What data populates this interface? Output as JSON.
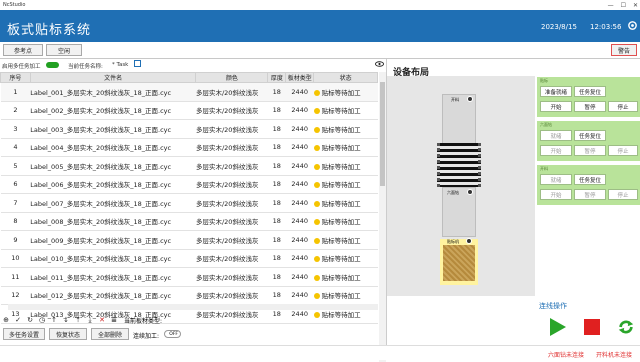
{
  "window": {
    "title": "NcStudio"
  },
  "header": {
    "app_title": "板式贴标系统",
    "date": "2023/8/15",
    "time": "12:03:56"
  },
  "toolbar": {
    "ref_point": "参考点",
    "idle": "空闲",
    "alarm": "警告"
  },
  "options": {
    "multi_task": "启用多任务加工",
    "current_task_label": "当前任务名称:",
    "current_task": "* Task"
  },
  "table": {
    "headers": [
      "序号",
      "文件名",
      "颜色",
      "厚度",
      "板材类型",
      "状态"
    ],
    "rows": [
      [
        "1",
        "Label_001_多层实木_20斜纹浅灰_18_正面.cyc",
        "多层实木/20斜纹浅灰",
        "18",
        "2440",
        "贴标等待加工"
      ],
      [
        "2",
        "Label_002_多层实木_20斜纹浅灰_18_正面.cyc",
        "多层实木/20斜纹浅灰",
        "18",
        "2440",
        "贴标等待加工"
      ],
      [
        "3",
        "Label_003_多层实木_20斜纹浅灰_18_正面.cyc",
        "多层实木/20斜纹浅灰",
        "18",
        "2440",
        "贴标等待加工"
      ],
      [
        "4",
        "Label_004_多层实木_20斜纹浅灰_18_正面.cyc",
        "多层实木/20斜纹浅灰",
        "18",
        "2440",
        "贴标等待加工"
      ],
      [
        "5",
        "Label_005_多层实木_20斜纹浅灰_18_正面.cyc",
        "多层实木/20斜纹浅灰",
        "18",
        "2440",
        "贴标等待加工"
      ],
      [
        "6",
        "Label_006_多层实木_20斜纹浅灰_18_正面.cyc",
        "多层实木/20斜纹浅灰",
        "18",
        "2440",
        "贴标等待加工"
      ],
      [
        "7",
        "Label_007_多层实木_20斜纹浅灰_18_正面.cyc",
        "多层实木/20斜纹浅灰",
        "18",
        "2440",
        "贴标等待加工"
      ],
      [
        "8",
        "Label_008_多层实木_20斜纹浅灰_18_正面.cyc",
        "多层实木/20斜纹浅灰",
        "18",
        "2440",
        "贴标等待加工"
      ],
      [
        "9",
        "Label_009_多层实木_20斜纹浅灰_18_正面.cyc",
        "多层实木/20斜纹浅灰",
        "18",
        "2440",
        "贴标等待加工"
      ],
      [
        "10",
        "Label_010_多层实木_20斜纹浅灰_18_正面.cyc",
        "多层实木/20斜纹浅灰",
        "18",
        "2440",
        "贴标等待加工"
      ],
      [
        "11",
        "Label_011_多层实木_20斜纹浅灰_18_正面.cyc",
        "多层实木/20斜纹浅灰",
        "18",
        "2440",
        "贴标等待加工"
      ],
      [
        "12",
        "Label_012_多层实木_20斜纹浅灰_18_正面.cyc",
        "多层实木/20斜纹浅灰",
        "18",
        "2440",
        "贴标等待加工"
      ],
      [
        "13",
        "Label_013_多层实木_20斜纹浅灰_18_正面.cyc",
        "多层实木/20斜纹浅灰",
        "18",
        "2440",
        "贴标等待加工"
      ]
    ]
  },
  "iconbar": {
    "current_type_label": "当前板材类型:"
  },
  "bottom": {
    "multi_task_settings": "多任务设置",
    "restore_state": "恢复状态",
    "delete_all": "全部删除",
    "continuous": "连续加工:",
    "toggle_state": "OFF"
  },
  "layout": {
    "title": "设备布局",
    "station_feed": "开料",
    "station_unload": "六面钻",
    "station_label": "贴标机"
  },
  "cards": {
    "c1": {
      "label": "贴标",
      "ready": "准备就绪",
      "reset": "任务复位",
      "start": "开始",
      "pause": "暂停",
      "stop": "停止"
    },
    "c2": {
      "label": "六面钻",
      "ready": "就绪",
      "reset": "任务复位",
      "start": "开始",
      "pause": "暂停",
      "stop": "停止"
    },
    "c3": {
      "label": "开料",
      "ready": "就绪",
      "reset": "任务复位",
      "start": "开始",
      "pause": "暂停",
      "stop": "停止"
    }
  },
  "ops": {
    "title": "连线操作"
  },
  "footer": {
    "msg1": "六面钻未连接",
    "msg2": "开料机未连接"
  },
  "colors": {
    "accent": "#1f6fb4",
    "card_green": "#b9e39a",
    "play": "#2aa52a",
    "stop": "#e02020",
    "status_dot": "#f5c400"
  }
}
